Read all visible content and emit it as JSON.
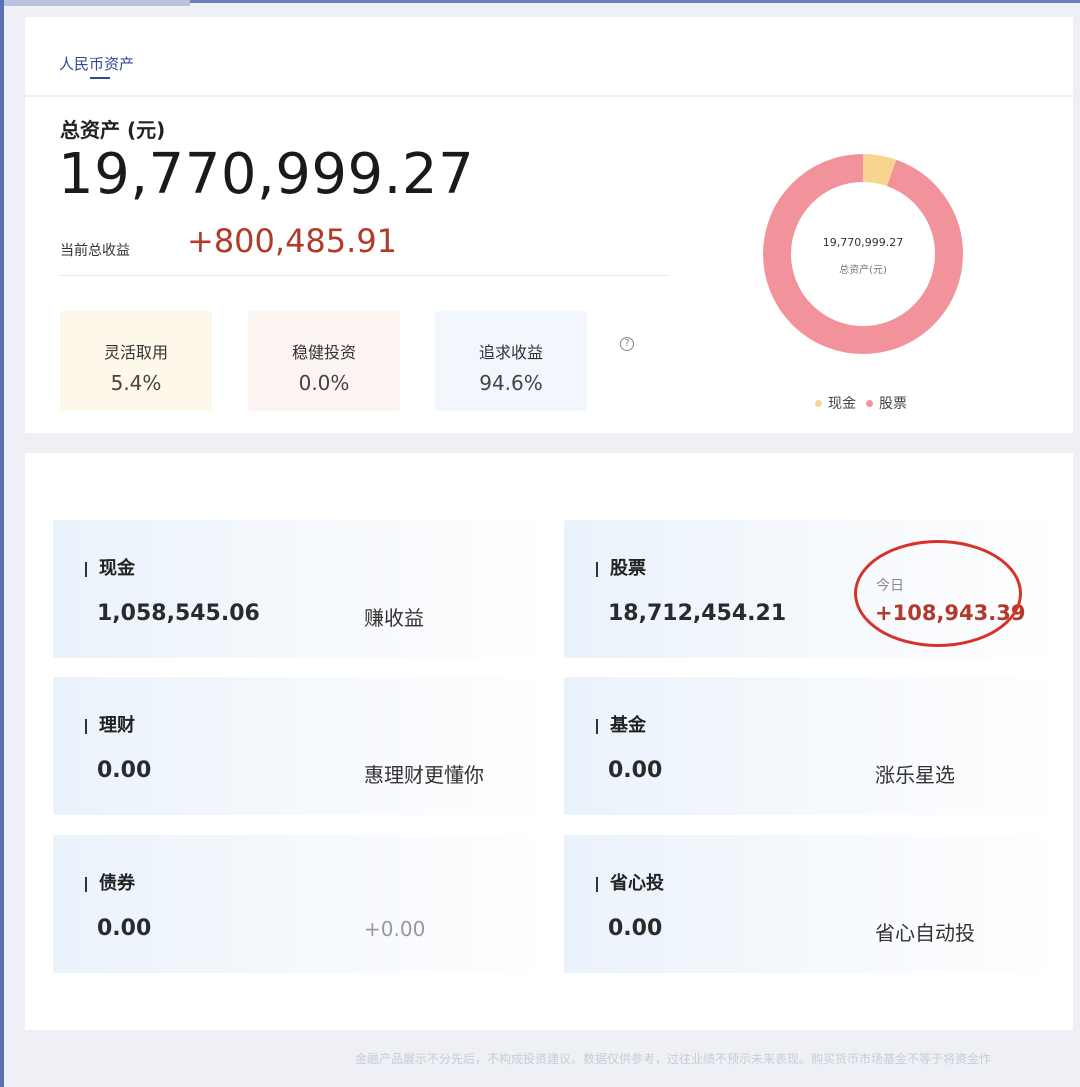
{
  "tabs": {
    "rmb_assets": "人民币资产"
  },
  "summary": {
    "total_label": "总资产 (元)",
    "total_value": "19,770,999.27",
    "profit_label": "当前总收益",
    "profit_value": "+800,485.91",
    "categories": [
      {
        "name": "灵活取用",
        "pct": "5.4%"
      },
      {
        "name": "稳健投资",
        "pct": "0.0%"
      },
      {
        "name": "追求收益",
        "pct": "94.6%"
      }
    ],
    "help_icon": "?"
  },
  "allocation_chart": {
    "center_value": "19,770,999.27",
    "center_label": "总资产(元)",
    "slices": [
      {
        "label": "现金",
        "fraction": 0.054,
        "color": "#f8d58e"
      },
      {
        "label": "股票",
        "fraction": 0.946,
        "color": "#f2939c"
      }
    ]
  },
  "holdings": {
    "cash": {
      "title": "现金",
      "value": "1,058,545.06",
      "note": "赚收益"
    },
    "stock": {
      "title": "股票",
      "value": "18,712,454.21",
      "today_label": "今日",
      "today_value": "+108,943.39"
    },
    "wealth": {
      "title": "理财",
      "value": "0.00",
      "note": "惠理财更懂你"
    },
    "fund": {
      "title": "基金",
      "value": "0.00",
      "note": "涨乐星选"
    },
    "bond": {
      "title": "债券",
      "value": "0.00",
      "note": "+0.00"
    },
    "auto_invest": {
      "title": "省心投",
      "value": "0.00",
      "note": "省心自动投"
    }
  },
  "disclaimer": "金融产品展示不分先后，不构成投资建议。数据仅供参考，过往业绩不预示未来表现。购买货币市场基金不等于将资金作"
}
